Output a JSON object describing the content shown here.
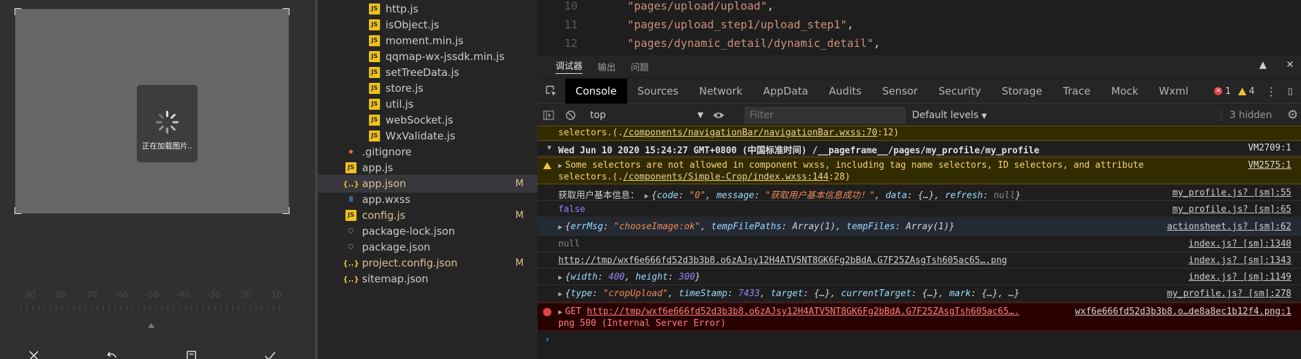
{
  "simulator": {
    "loading_text": "正在加载图片..",
    "ruler_labels": [
      "-90",
      "-80",
      "-70",
      "-60",
      "-50",
      "-40",
      "-30",
      "-20",
      "-10"
    ],
    "bottom_icons": [
      "close-icon",
      "undo-icon",
      "crop-frame-icon",
      "check-icon"
    ]
  },
  "explorer": {
    "files": [
      {
        "name": "http.js",
        "icon": "js",
        "modified": ""
      },
      {
        "name": "isObject.js",
        "icon": "js",
        "modified": ""
      },
      {
        "name": "moment.min.js",
        "icon": "js",
        "modified": ""
      },
      {
        "name": "qqmap-wx-jssdk.min.js",
        "icon": "js",
        "modified": ""
      },
      {
        "name": "setTreeData.js",
        "icon": "js",
        "modified": ""
      },
      {
        "name": "store.js",
        "icon": "js",
        "modified": ""
      },
      {
        "name": "util.js",
        "icon": "js",
        "modified": ""
      },
      {
        "name": "webSocket.js",
        "icon": "js",
        "modified": ""
      },
      {
        "name": "WxValidate.js",
        "icon": "js",
        "modified": ""
      },
      {
        "name": ".gitignore",
        "icon": "git",
        "modified": ""
      },
      {
        "name": "app.js",
        "icon": "js",
        "modified": ""
      },
      {
        "name": "app.json",
        "icon": "json",
        "modified": "M"
      },
      {
        "name": "app.wxss",
        "icon": "css",
        "modified": ""
      },
      {
        "name": "config.js",
        "icon": "js",
        "modified": "M"
      },
      {
        "name": "package-lock.json",
        "icon": "npm",
        "modified": ""
      },
      {
        "name": "package.json",
        "icon": "npm",
        "modified": ""
      },
      {
        "name": "project.config.json",
        "icon": "json",
        "modified": "M"
      },
      {
        "name": "sitemap.json",
        "icon": "json",
        "modified": ""
      }
    ]
  },
  "editor": {
    "lines": [
      {
        "num": "10",
        "text": "\"pages/upload/upload\"",
        "punc": ","
      },
      {
        "num": "11",
        "text": "\"pages/upload_step1/upload_step1\"",
        "punc": ","
      },
      {
        "num": "12",
        "text": "\"pages/dynamic_detail/dynamic_detail\"",
        "punc": ","
      }
    ]
  },
  "panel_tabs": [
    "调试器",
    "输出",
    "问题"
  ],
  "devtools": {
    "tabs": [
      "Console",
      "Sources",
      "Network",
      "AppData",
      "Audits",
      "Sensor",
      "Security",
      "Storage",
      "Trace",
      "Mock",
      "Wxml"
    ],
    "error_count": "1",
    "warning_count": "4",
    "context": "top",
    "filter_placeholder": "Filter",
    "levels": "Default levels",
    "hidden": "3 hidden"
  },
  "console": {
    "warn1_tail_a": "selectors.(.",
    "warn1_link": "/components/navigationBar/navigationBar.wxss:70",
    "warn1_tail_b": ":12)",
    "group_title": "Wed Jun 10 2020 15:24:27 GMT+0800 (中国标准时间) /__pageframe__/pages/my_profile/my_profile",
    "group_src": "VM2709:1",
    "warn2_line1": "Some selectors are not allowed in component wxss, including tag name selectors, ID selectors, and attribute",
    "warn2_line2_a": "selectors.(.",
    "warn2_link": "/components/Simple-Crop/index.wxss:144",
    "warn2_line2_b": ":28)",
    "warn2_src": "VM2575:1",
    "log1_label": "获取用户基本信息：",
    "log1_code": "\"0\"",
    "log1_msg": "\"获取用户基本信息成功！\"",
    "log1_src": "my_profile.js? [sm]:55",
    "log2": "false",
    "log2_src": "my_profile.js? [sm]:65",
    "log3_errmsg": "\"chooseImage:ok\"",
    "log3_src": "actionsheet.js? [sm]:62",
    "log4": "null",
    "log4_src": "index.js? [sm]:1340",
    "log5_url": "http://tmp/wxf6e666fd52d3b3b8.o6zAJsy12H4ATV5NT8GK6Fg2bBdA.G7F25ZAsgTsh605ac65….png",
    "log5_src": "index.js? [sm]:1343",
    "log6_width": "400",
    "log6_height": "300",
    "log6_src": "index.js? [sm]:1149",
    "log7_type": "\"cropUpload\"",
    "log7_ts": "7433",
    "log7_src": "my_profile.js? [sm]:278",
    "err_method": "GET",
    "err_url": "http://tmp/wxf6e666fd52d3b3b8.o6zAJsy12H4ATV5NT8GK6Fg2bBdA.G7F25ZAsgTsh605ac65….",
    "err_src": "wxf6e666fd52d3b3b8.o…de8a8ec1b12f4.png:1",
    "err_line2": "png 500 (Internal Server Error)"
  },
  "colors": {
    "accent_warn": "#f2c237",
    "accent_err": "#e2414c",
    "string": "#ce9178"
  }
}
